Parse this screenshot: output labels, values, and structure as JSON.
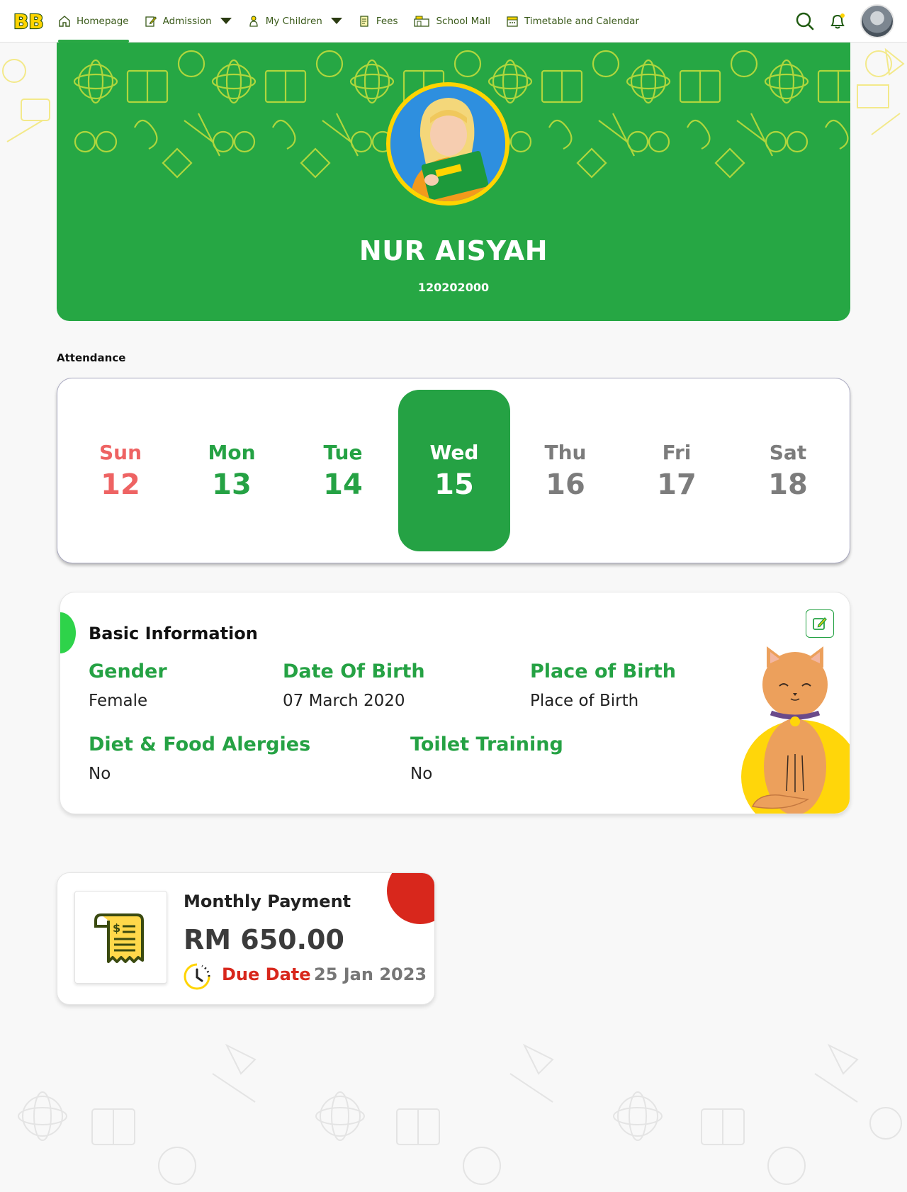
{
  "nav": {
    "logo_text": "BB",
    "items": [
      {
        "label": "Homepage",
        "icon": "home-icon",
        "active": true
      },
      {
        "label": "Admission",
        "icon": "edit-document-icon",
        "dropdown": true
      },
      {
        "label": "My Children",
        "icon": "child-icon",
        "dropdown": true
      },
      {
        "label": "Fees",
        "icon": "receipt-icon"
      },
      {
        "label": "School Mall",
        "icon": "shop-icon"
      },
      {
        "label": "Timetable and Calendar",
        "icon": "calendar-icon"
      }
    ],
    "right": {
      "search_icon": "search-icon",
      "bell_icon": "bell-icon",
      "avatar": "user-avatar"
    }
  },
  "profile": {
    "name": "NUR AISYAH",
    "id_number": "120202000"
  },
  "attendance": {
    "label": "Attendance",
    "days": [
      {
        "name": "Sun",
        "num": "12"
      },
      {
        "name": "Mon",
        "num": "13"
      },
      {
        "name": "Tue",
        "num": "14"
      },
      {
        "name": "Wed",
        "num": "15"
      },
      {
        "name": "Thu",
        "num": "16"
      },
      {
        "name": "Fri",
        "num": "17"
      },
      {
        "name": "Sat",
        "num": "18"
      }
    ],
    "selected_day": "Wed"
  },
  "basic_info": {
    "title": "Basic Information",
    "gender_label": "Gender",
    "gender_value": "Female",
    "dob_label": "Date Of Birth",
    "dob_value": "07 March 2020",
    "pob_label": "Place of Birth",
    "pob_value": "Place of Birth",
    "diet_label": "Diet & Food Alergies",
    "diet_value": "No",
    "toilet_label": "Toilet Training",
    "toilet_value": "No"
  },
  "payment": {
    "title": "Monthly Payment",
    "amount": "RM 650.00",
    "due_label": "Due Date",
    "due_date": "25 Jan 2023"
  },
  "colors": {
    "primary_green": "#26a744",
    "accent_yellow": "#ffd400",
    "alert_red": "#d8271c",
    "sunday_red": "#ee6363"
  }
}
